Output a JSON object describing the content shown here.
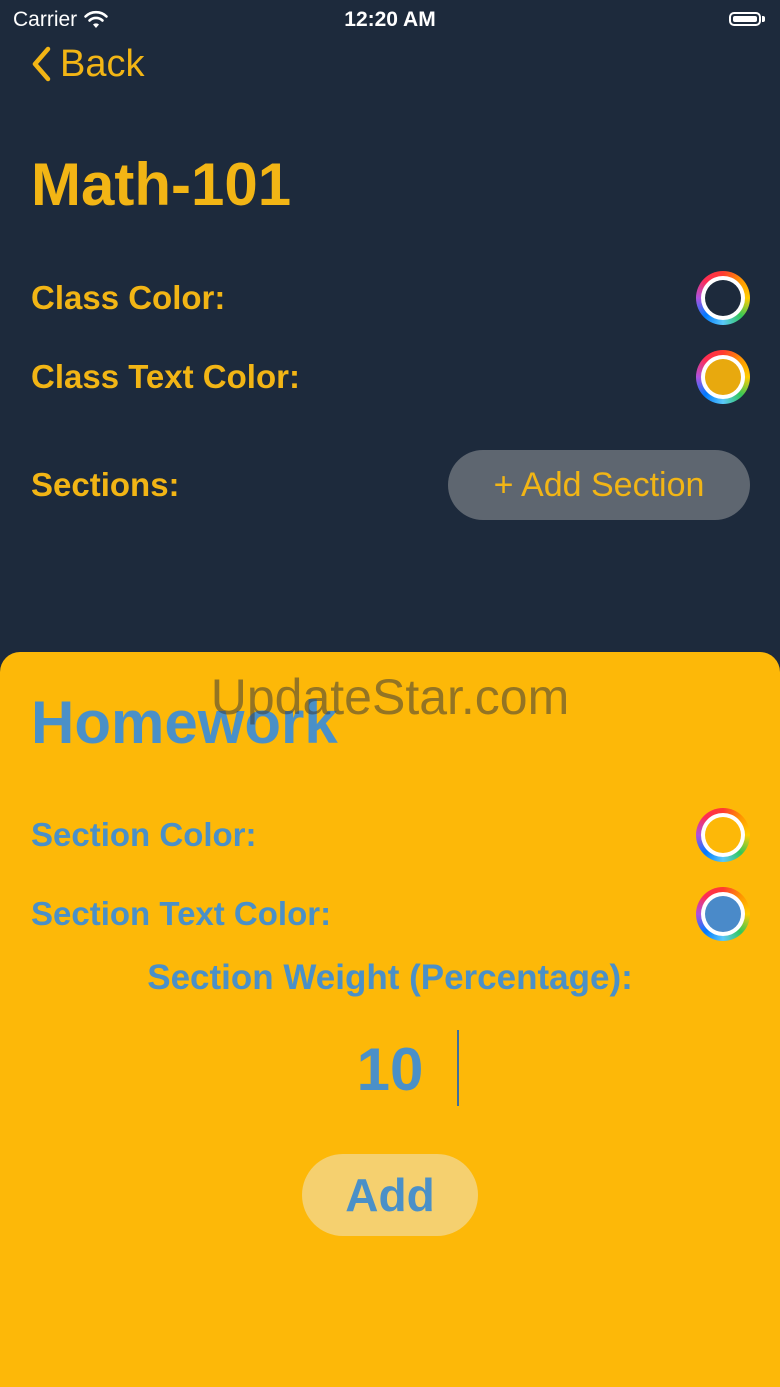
{
  "status_bar": {
    "carrier": "Carrier",
    "time": "12:20 AM"
  },
  "nav": {
    "back_label": "Back"
  },
  "class": {
    "title": "Math-101",
    "color_label": "Class Color:",
    "color_value": "#1d2a3c",
    "text_color_label": "Class Text Color:",
    "text_color_value": "#e8a90e",
    "sections_label": "Sections:",
    "add_section_label": "+ Add Section"
  },
  "watermark": "UpdateStar.com",
  "new_section": {
    "title": "Homework",
    "color_label": "Section Color:",
    "color_value": "#fdb808",
    "text_color_label": "Section Text Color:",
    "text_color_value": "#4a8ac9",
    "weight_label": "Section Weight (Percentage):",
    "weight_value": "10",
    "add_label": "Add"
  },
  "colors": {
    "background": "#1d2a3c",
    "accent": "#f2b515",
    "sheet": "#fdb808",
    "section_text": "#4a90c8"
  }
}
